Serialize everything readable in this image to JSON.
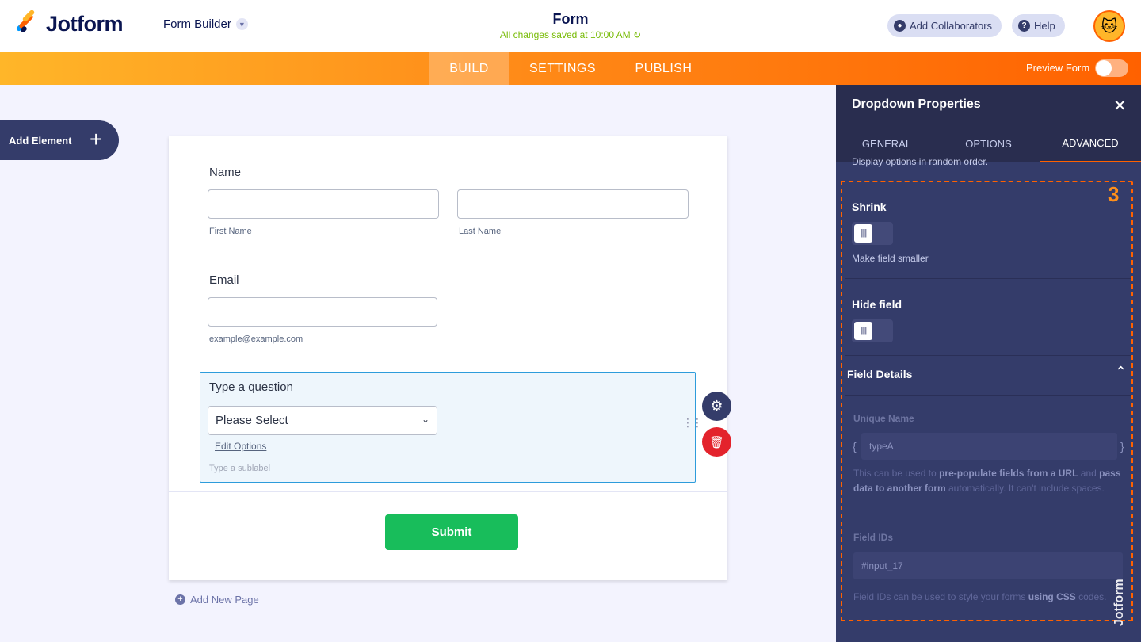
{
  "header": {
    "brand": "Jotform",
    "builder_menu": "Form Builder",
    "form_title": "Form",
    "save_status": "All changes saved at 10:00 AM",
    "add_collaborators": "Add Collaborators",
    "help": "Help"
  },
  "nav": {
    "tabs": [
      {
        "label": "BUILD",
        "active": true
      },
      {
        "label": "SETTINGS",
        "active": false
      },
      {
        "label": "PUBLISH",
        "active": false
      }
    ],
    "preview_label": "Preview Form"
  },
  "sidebar": {
    "add_element": "Add Element"
  },
  "form": {
    "name_label": "Name",
    "first_name_sub": "First Name",
    "last_name_sub": "Last Name",
    "email_label": "Email",
    "email_sub": "example@example.com",
    "question_label": "Type a question",
    "select_value": "Please Select",
    "edit_options": "Edit Options",
    "sublabel_placeholder": "Type a sublabel",
    "submit": "Submit",
    "add_new_page": "Add New Page"
  },
  "panel": {
    "title": "Dropdown Properties",
    "tabs": [
      {
        "label": "GENERAL",
        "active": false
      },
      {
        "label": "OPTIONS",
        "active": false
      },
      {
        "label": "ADVANCED",
        "active": true
      }
    ],
    "cut_text": "Display options in random order.",
    "highlight_number": "3",
    "shrink": {
      "label": "Shrink",
      "sub": "Make field smaller",
      "on": false
    },
    "hide_field": {
      "label": "Hide field",
      "on": false
    },
    "field_details": "Field Details",
    "unique_name": {
      "label": "Unique Name",
      "value": "typeA",
      "help_pre": "This can be used to ",
      "help_bold1": "pre-populate fields from a URL",
      "help_mid": " and ",
      "help_bold2": "pass data to another form",
      "help_post": " automatically. It can't include spaces."
    },
    "field_ids": {
      "label": "Field IDs",
      "value": "#input_17",
      "help_pre": "Field IDs can be used to style your forms ",
      "help_bold": "using CSS",
      "help_post": " codes."
    }
  },
  "colors": {
    "orange": "#ff6100",
    "navy": "#0a1551",
    "panel_bg": "#343c6a",
    "submit_green": "#18bd5b",
    "delete_red": "#e3232c"
  }
}
